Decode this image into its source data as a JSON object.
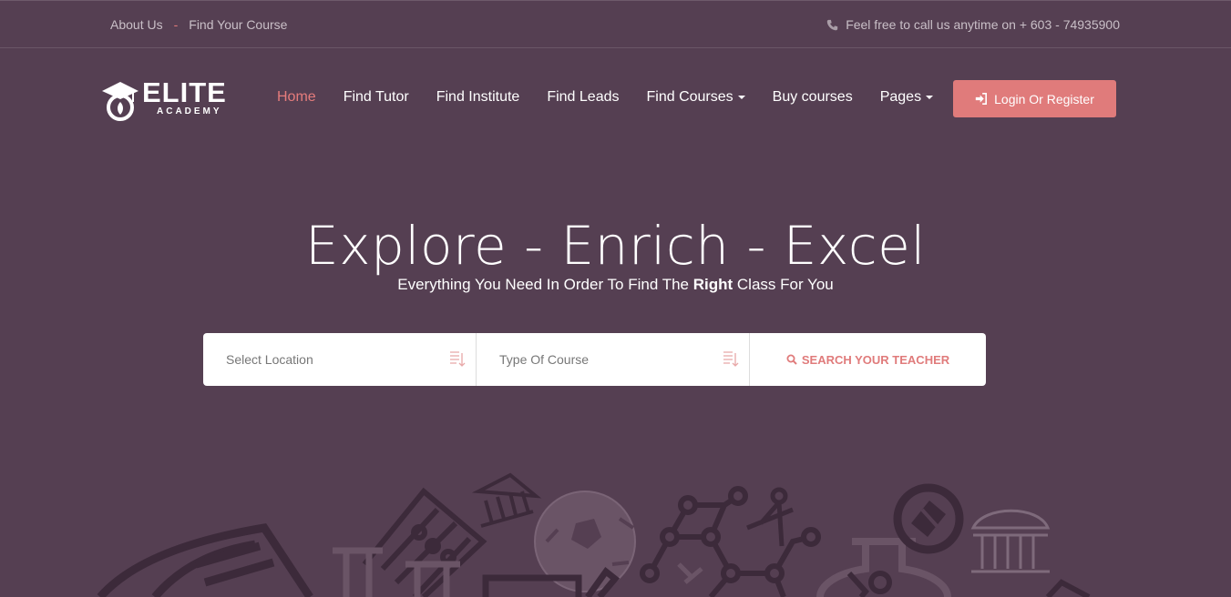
{
  "topbar": {
    "about": "About Us",
    "separator": "-",
    "find_course": "Find Your Course",
    "phone_text": "Feel free to call us anytime on + 603 - 74935900"
  },
  "logo": {
    "word": "ELITE",
    "sub": "ACADEMY"
  },
  "nav": [
    {
      "label": "Home"
    },
    {
      "label": "Find Tutor"
    },
    {
      "label": "Find Institute"
    },
    {
      "label": "Find Leads"
    },
    {
      "label": "Find Courses"
    },
    {
      "label": "Buy courses"
    },
    {
      "label": "Pages"
    }
  ],
  "login_label": "Login Or Register",
  "hero": {
    "title": "Explore - Enrich - Excel",
    "sub_before": "Everything You Need In Order To Find The ",
    "sub_bold": "Right",
    "sub_after": " Class For You"
  },
  "search": {
    "location_placeholder": "Select Location",
    "course_placeholder": "Type Of Course",
    "button_label": "SEARCH YOUR TEACHER"
  },
  "colors": {
    "background": "#553f52",
    "accent": "#e07b7b",
    "illustration": "#3c2a3a"
  }
}
